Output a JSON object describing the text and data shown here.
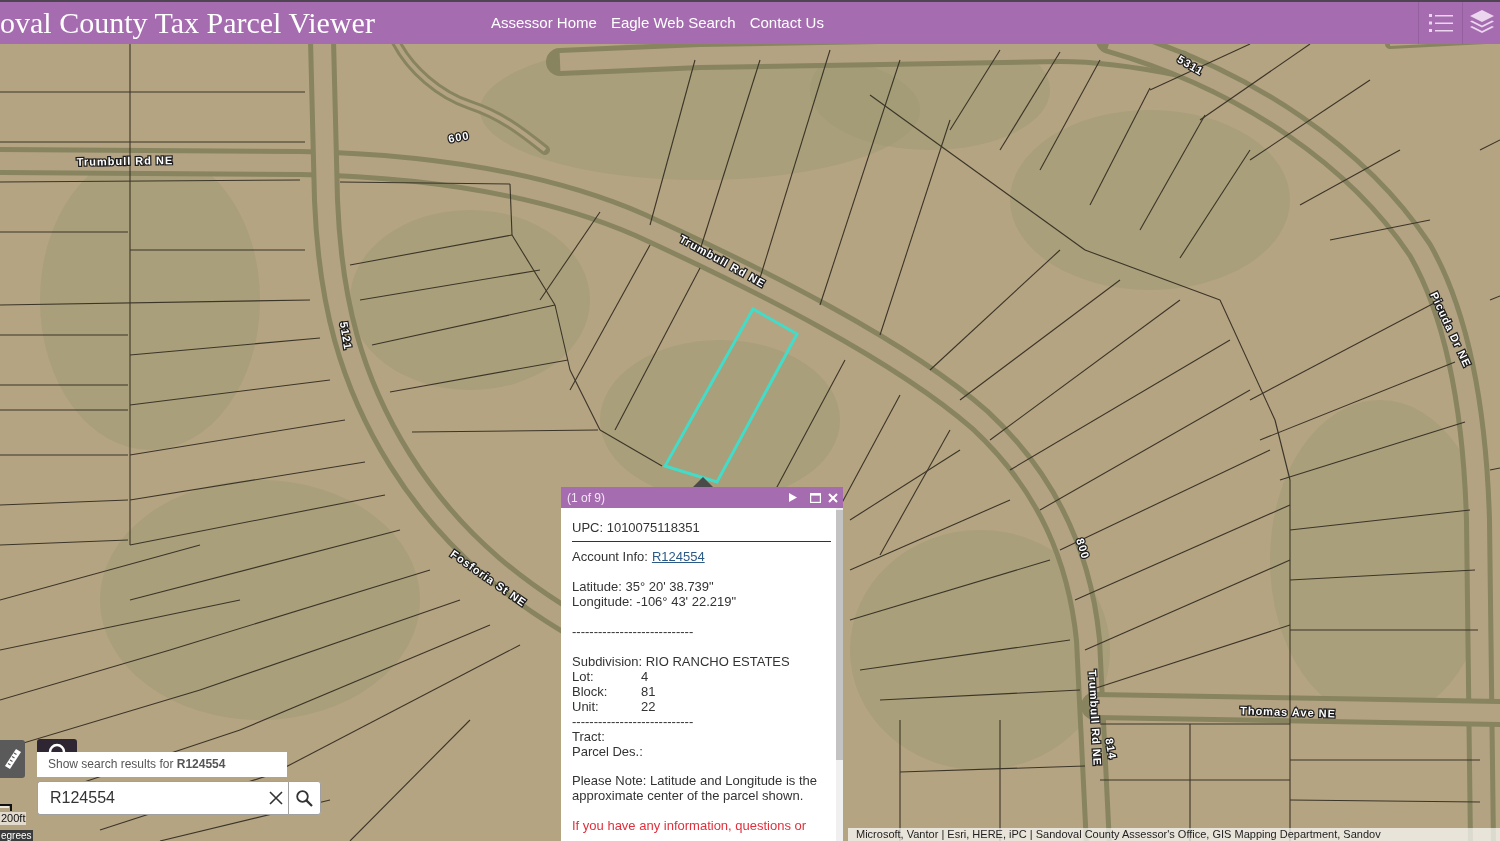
{
  "header": {
    "title": "oval County Tax Parcel Viewer",
    "nav_links": [
      {
        "label": "Assessor Home"
      },
      {
        "label": "Eagle Web Search"
      },
      {
        "label": "Contact Us"
      }
    ]
  },
  "map": {
    "labels": [
      "Trumbull Rd NE",
      "600",
      "Trumbull Rd NE",
      "5311",
      "5121",
      "Picuda Dr NE",
      "Fosforia St NE",
      "800",
      "Trumbull Rd NE",
      "Thomas Ave NE",
      "814"
    ],
    "scale_label": "200ft",
    "units_label": "egrees",
    "attribution": "Microsoft, Vantor | Esri, HERE, iPC | Sandoval County Assessor's Office, GIS Mapping Department, Sandov"
  },
  "popup": {
    "counter": "(1 of 9)",
    "upc": "UPC: 1010075118351",
    "account_label": "Account Info:",
    "account_link": "R124554",
    "coordinates": [
      "Latitude: 35° 20' 38.739\"",
      "Longitude: -106° 43' 22.219\""
    ],
    "separator_1": "----------------------------",
    "subdivision": "Subdivision: RIO RANCHO ESTATES",
    "fields": [
      {
        "label": "Lot:",
        "value": "4"
      },
      {
        "label": "Block:",
        "value": "81"
      },
      {
        "label": "Unit:",
        "value": "22"
      }
    ],
    "separator_2": "----------------------------",
    "empty_fields": [
      "Tract:",
      "Parcel Des.:"
    ],
    "note": "Please Note: Latitude and Longitude is the approximate center of the parcel shown.",
    "contact_note": "If you have any information, questions or"
  },
  "search": {
    "suggestion": "Show search results for **R124554**",
    "value": "R124554"
  }
}
